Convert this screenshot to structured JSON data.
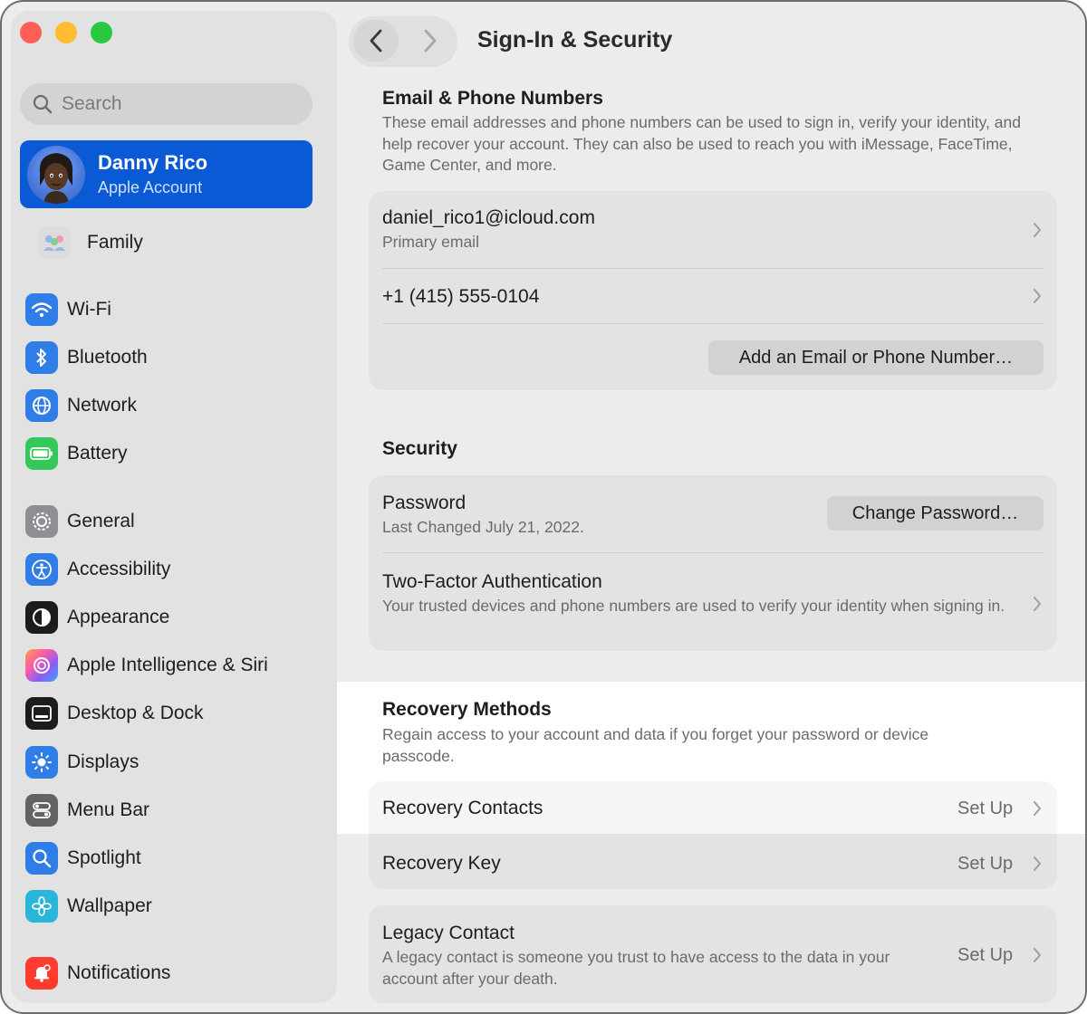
{
  "window": {
    "title": "Sign-In & Security"
  },
  "sidebar": {
    "search_placeholder": "Search",
    "account": {
      "name": "Danny Rico",
      "subtitle": "Apple Account"
    },
    "items": [
      {
        "label": "Family",
        "icon": "family-icon",
        "color": "#d9d9d9"
      },
      {
        "label": "Wi-Fi",
        "icon": "wifi-icon",
        "color": "#2f80ed"
      },
      {
        "label": "Bluetooth",
        "icon": "bluetooth-icon",
        "color": "#2f80ed"
      },
      {
        "label": "Network",
        "icon": "globe-icon",
        "color": "#2f80ed"
      },
      {
        "label": "Battery",
        "icon": "battery-icon",
        "color": "#34c759"
      },
      {
        "label": "General",
        "icon": "gear-icon",
        "color": "#8e8e93"
      },
      {
        "label": "Accessibility",
        "icon": "accessibility-icon",
        "color": "#2f80ed"
      },
      {
        "label": "Appearance",
        "icon": "appearance-icon",
        "color": "#1c1c1e"
      },
      {
        "label": "Apple Intelligence & Siri",
        "icon": "siri-icon",
        "color": "#b36bff"
      },
      {
        "label": "Desktop & Dock",
        "icon": "dock-icon",
        "color": "#1c1c1e"
      },
      {
        "label": "Displays",
        "icon": "sun-icon",
        "color": "#2f80ed"
      },
      {
        "label": "Menu Bar",
        "icon": "menubar-icon",
        "color": "#636366"
      },
      {
        "label": "Spotlight",
        "icon": "magnifier-icon",
        "color": "#2f80ed"
      },
      {
        "label": "Wallpaper",
        "icon": "flower-icon",
        "color": "#29b6d9"
      },
      {
        "label": "Notifications",
        "icon": "bell-icon",
        "color": "#ff3b30"
      }
    ]
  },
  "email_section": {
    "title": "Email & Phone Numbers",
    "description": "These email addresses and phone numbers can be used to sign in, verify your identity, and help recover your account. They can also be used to reach you with iMessage, FaceTime, Game Center, and more.",
    "email": "daniel_rico1@icloud.com",
    "email_sub": "Primary email",
    "phone": "+1 (415) 555-0104",
    "add_button": "Add an Email or Phone Number…"
  },
  "security_section": {
    "title": "Security",
    "password_title": "Password",
    "password_sub": "Last Changed July 21, 2022.",
    "change_button": "Change Password…",
    "twofa_title": "Two-Factor Authentication",
    "twofa_sub": "Your trusted devices and phone numbers are used to verify your identity when signing in."
  },
  "recovery_section": {
    "title": "Recovery Methods",
    "description": "Regain access to your account and data if you forget your password or device passcode.",
    "contacts_title": "Recovery Contacts",
    "contacts_action": "Set Up",
    "key_title": "Recovery Key",
    "key_action": "Set Up"
  },
  "legacy_section": {
    "title": "Legacy Contact",
    "description": "A legacy contact is someone you trust to have access to the data in your account after your death.",
    "action": "Set Up"
  }
}
